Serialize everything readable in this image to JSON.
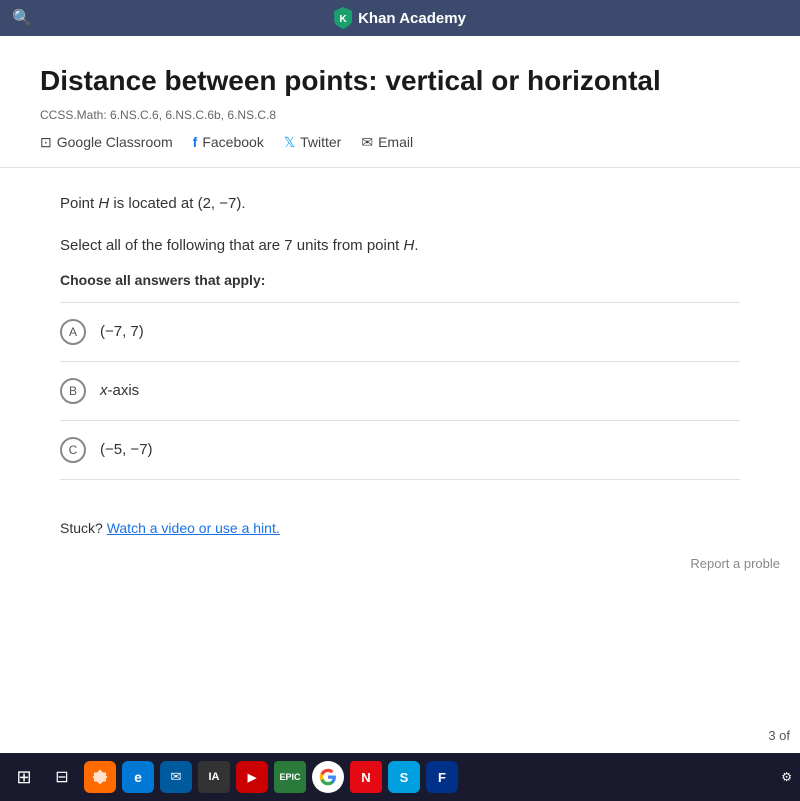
{
  "browser": {
    "search_icon": "🔍",
    "khan_name": "Khan Academy"
  },
  "page": {
    "title": "Distance between points: vertical or\nhorizontal",
    "ccss": "CCSS.Math: 6.NS.C.6, 6.NS.C.6b, 6.NS.C.8",
    "share": {
      "google_classroom": "Google Classroom",
      "facebook": "Facebook",
      "twitter": "Twitter",
      "email": "Email"
    }
  },
  "question": {
    "point_info": "Point H is located at (2, −7).",
    "instruction": "Select all of the following that are 7 units from point H.",
    "choose_label": "Choose all answers that apply:",
    "options": [
      {
        "id": "A",
        "text": "(−7, 7)"
      },
      {
        "id": "B",
        "text": "x-axis"
      },
      {
        "id": "C",
        "text": "(−5, −7)"
      }
    ]
  },
  "stuck": {
    "prefix": "Stuck?",
    "link_text": "Watch a video or use a hint."
  },
  "report": {
    "text": "Report a proble"
  },
  "taskbar": {
    "page_counter": "3 of"
  }
}
